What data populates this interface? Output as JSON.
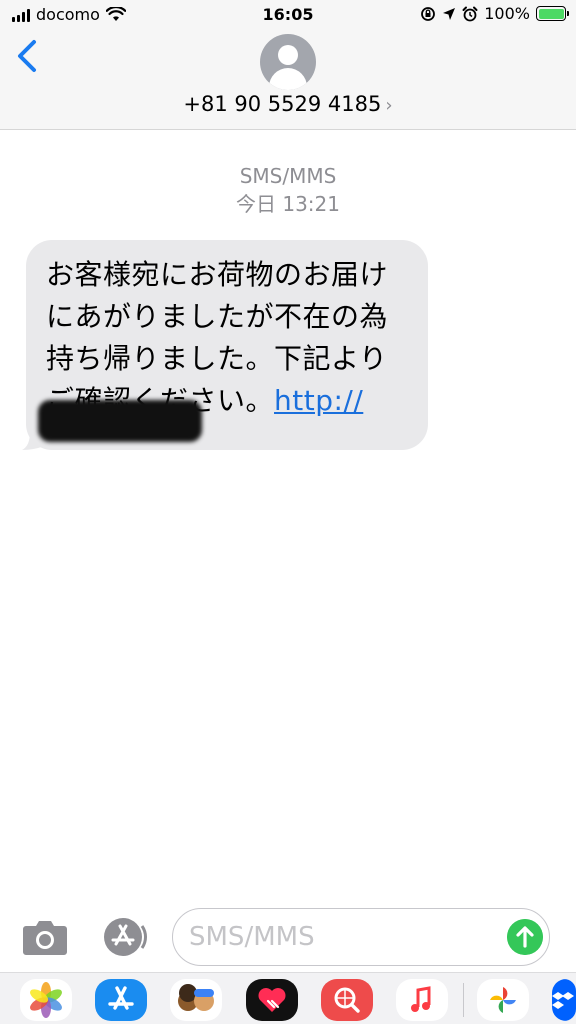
{
  "status": {
    "carrier": "docomo",
    "time": "16:05",
    "battery": "100%"
  },
  "header": {
    "contact": "+81 90 5529 4185",
    "contact_chevron": "›"
  },
  "message_meta": {
    "service": "SMS/MMS",
    "timestamp": "今日 13:21"
  },
  "message": {
    "text": "お客様宛にお荷物のお届けにあがりましたが不在の為持ち帰りました。下記よりご確認ください。",
    "link": "http://"
  },
  "composer": {
    "placeholder": "SMS/MMS",
    "value": ""
  },
  "app_drawer": [
    {
      "icon": "photos-icon"
    },
    {
      "icon": "app-store-icon"
    },
    {
      "icon": "memoji-icon"
    },
    {
      "icon": "digital-touch-icon"
    },
    {
      "icon": "image-search-icon"
    },
    {
      "icon": "music-icon"
    },
    {
      "icon": "google-photos-icon"
    },
    {
      "icon": "dropbox-icon"
    }
  ],
  "colors": {
    "accent": "#1a7bf0",
    "bubble": "#e9e9eb",
    "send": "#34c759",
    "link": "#1a6fdc"
  }
}
